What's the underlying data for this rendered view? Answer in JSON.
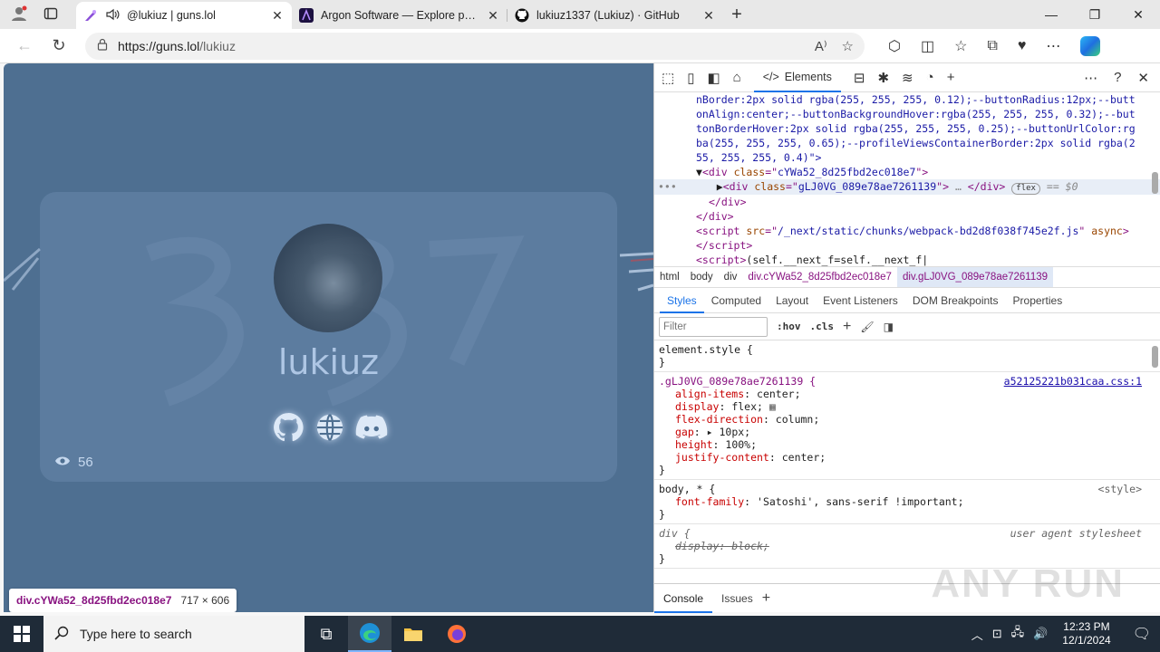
{
  "browser": {
    "tabs": [
      {
        "title": "@lukiuz | guns.lol",
        "active": true
      },
      {
        "title": "Argon Software — Explore produ",
        "active": false
      },
      {
        "title": "lukiuz1337 (Lukiuz) · GitHub",
        "active": false
      }
    ],
    "url_host": "https://guns.lol",
    "url_path": "/lukiuz"
  },
  "page": {
    "username": "lukiuz",
    "views": "56",
    "inspect_selector": "div.cYWa52_8d25fbd2ec018e7",
    "inspect_size": "717 × 606",
    "socials": [
      "github-icon",
      "globe-icon",
      "discord-icon"
    ]
  },
  "devtools": {
    "active_tab": "Elements",
    "dom_lines": [
      "nBorder:2px solid rgba(255, 255, 255, 0.12);--buttonRadius:12px;--butt",
      "onAlign:center;--buttonBackgroundHover:rgba(255, 255, 255, 0.32);--but",
      "tonBorderHover:2px solid rgba(255, 255, 255, 0.25);--buttonUrlColor:rg",
      "ba(255, 255, 255, 0.65);--profileViewsContainerBorder:2px solid rgba(2",
      "55, 255, 255, 0.4)\">"
    ],
    "dom_div_open_class": "cYWa52_8d25fbd2ec018e7",
    "dom_selected_class": "gLJ0VG_089e78ae7261139",
    "dom_flex_badge": "flex",
    "dom_eq": "== $0",
    "dom_script_src": "/_next/static/chunks/webpack-bd2d8f038f745e2f.js",
    "dom_script_attr": "async",
    "dom_inline_script": "(self.__next_f=self.__next_f|",
    "breadcrumbs": [
      "html",
      "body",
      "div",
      "div.cYWa52_8d25fbd2ec018e7",
      "div.gLJ0VG_089e78ae7261139"
    ],
    "subtabs": [
      "Styles",
      "Computed",
      "Layout",
      "Event Listeners",
      "DOM Breakpoints",
      "Properties"
    ],
    "filter_placeholder": "Filter",
    "filter_buttons": [
      ":hov",
      ".cls"
    ],
    "element_style": "element.style {",
    "rule1_selector": ".gLJ0VG_089e78ae7261139 {",
    "rule1_source": "a52125221b031caa.css:1",
    "rule1_props": [
      {
        "name": "align-items",
        "value": "center;"
      },
      {
        "name": "display",
        "value": "flex;"
      },
      {
        "name": "flex-direction",
        "value": "column;"
      },
      {
        "name": "gap",
        "value": "▸ 10px;"
      },
      {
        "name": "height",
        "value": "100%;"
      },
      {
        "name": "justify-content",
        "value": "center;"
      }
    ],
    "rule2_selector": "body, * {",
    "rule2_source": "<style>",
    "rule2_prop_name": "font-family",
    "rule2_prop_value": "'Satoshi', sans-serif !important;",
    "rule3_selector": "div {",
    "rule3_source": "user agent stylesheet",
    "rule3_prop": "display: block;",
    "drawer_tabs": [
      "Console",
      "Issues"
    ]
  },
  "taskbar": {
    "search_placeholder": "Type here to search",
    "time": "12:23 PM",
    "date": "12/1/2024"
  },
  "watermark": "ANY RUN"
}
